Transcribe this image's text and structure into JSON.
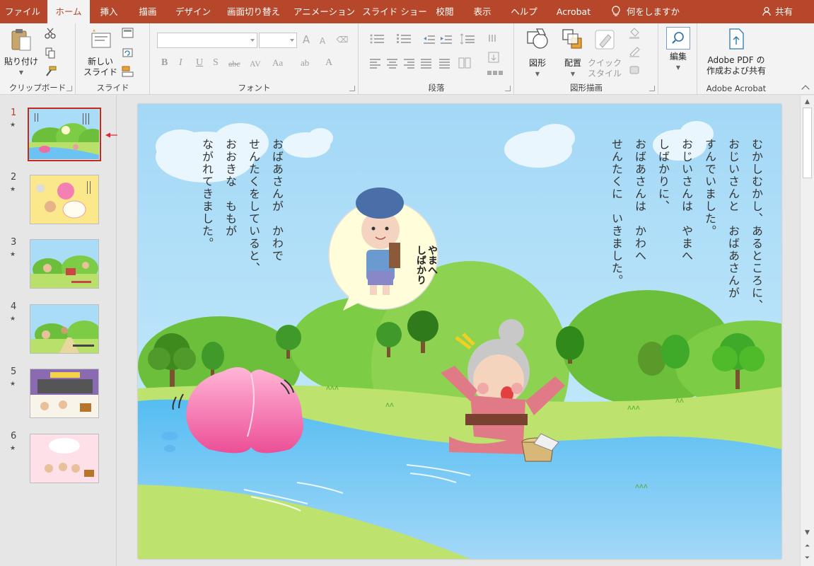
{
  "tabs": [
    {
      "label": "ファイル",
      "active": false
    },
    {
      "label": "ホーム",
      "active": true
    },
    {
      "label": "挿入",
      "active": false
    },
    {
      "label": "描画",
      "active": false
    },
    {
      "label": "デザイン",
      "active": false
    },
    {
      "label": "画面切り替え",
      "active": false
    },
    {
      "label": "アニメーション",
      "active": false
    },
    {
      "label": "スライド ショー",
      "active": false
    },
    {
      "label": "校閲",
      "active": false
    },
    {
      "label": "表示",
      "active": false
    },
    {
      "label": "ヘルプ",
      "active": false
    },
    {
      "label": "Acrobat",
      "active": false
    }
  ],
  "tell_me": "何をしますか",
  "share": "共有",
  "ribbon": {
    "clipboard": {
      "label": "クリップボード",
      "paste": "貼り付け"
    },
    "slides": {
      "label": "スライド",
      "new_slide_1": "新しい",
      "new_slide_2": "スライド"
    },
    "font": {
      "label": "フォント"
    },
    "paragraph": {
      "label": "段落"
    },
    "drawing": {
      "label": "図形描画",
      "shapes": "図形",
      "arrange": "配置",
      "quick_1": "クイック",
      "quick_2": "スタイル"
    },
    "editing": {
      "label": "編集"
    },
    "acrobat": {
      "label": "Adobe Acrobat",
      "pdf_1": "Adobe PDF の",
      "pdf_2": "作成および共有"
    }
  },
  "slides": [
    {
      "number": "1",
      "selected": true
    },
    {
      "number": "2",
      "selected": false
    },
    {
      "number": "3",
      "selected": false
    },
    {
      "number": "4",
      "selected": false
    },
    {
      "number": "5",
      "selected": false
    },
    {
      "number": "6",
      "selected": false
    }
  ],
  "slide_text": {
    "right_lines": [
      "むかしむかし、あるところに、",
      "おじいさんと　おばあさんが",
      "すんでいました。",
      "おじいさんは　やまへ",
      "しばかりに、",
      "おばあさんは　かわへ",
      "せんたくに　いきました。"
    ],
    "left_lines": [
      "おばあさんが　かわで",
      "せんたくをしていると、",
      "おおきな　ももが",
      "ながれてきました。"
    ],
    "speech_lines": [
      "やまへ",
      "しばかり"
    ]
  },
  "colors": {
    "accent": "#b7472a",
    "selected_border": "#c42b1c"
  }
}
